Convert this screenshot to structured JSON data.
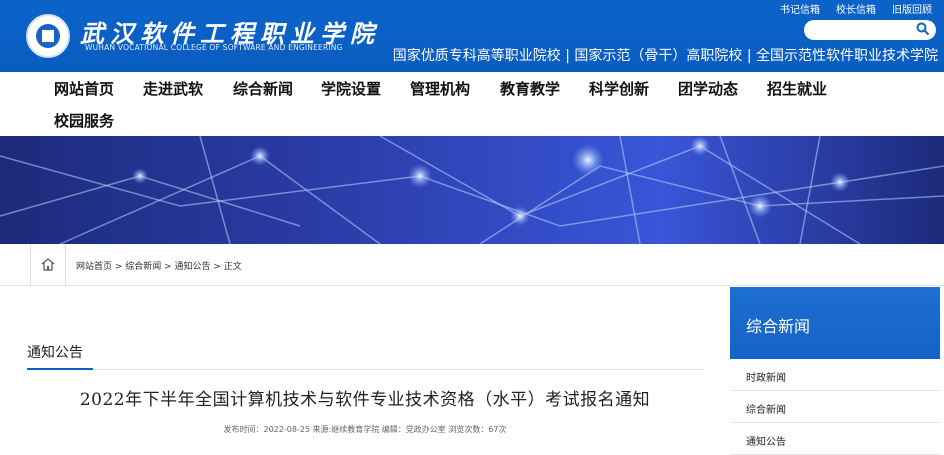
{
  "header": {
    "school_name": "武汉软件工程职业学院",
    "school_name_en": "WUHAN VOCATIONAL COLLEGE OF SOFTWARE AND ENGINEERING",
    "top_links": [
      "书记信箱",
      "校长信箱",
      "旧版回顾"
    ],
    "slogan": "国家优质专科高等职业院校 | 国家示范（骨干）高职院校 | 全国示范性软件职业技术学院",
    "search_placeholder": ""
  },
  "nav": {
    "items": [
      "网站首页",
      "走进武软",
      "综合新闻",
      "学院设置",
      "管理机构",
      "教育教学",
      "科学创新",
      "团学动态",
      "招生就业",
      "校园服务"
    ]
  },
  "breadcrumb": {
    "text": "网站首页 > 综合新闻 > 通知公告 > 正文"
  },
  "article": {
    "section_title": "通知公告",
    "title": "2022年下半年全国计算机技术与软件专业技术资格（水平）考试报名通知",
    "meta": "发布时间：2022-08-25 来源:继续教育学院 编辑：党政办公室 浏览次数：67次"
  },
  "sidebar": {
    "title": "综合新闻",
    "items": [
      "时政新闻",
      "综合新闻",
      "通知公告"
    ]
  },
  "colors": {
    "brand_blue": "#0b63c9",
    "sidebar_blue": "#1e6fd2"
  }
}
